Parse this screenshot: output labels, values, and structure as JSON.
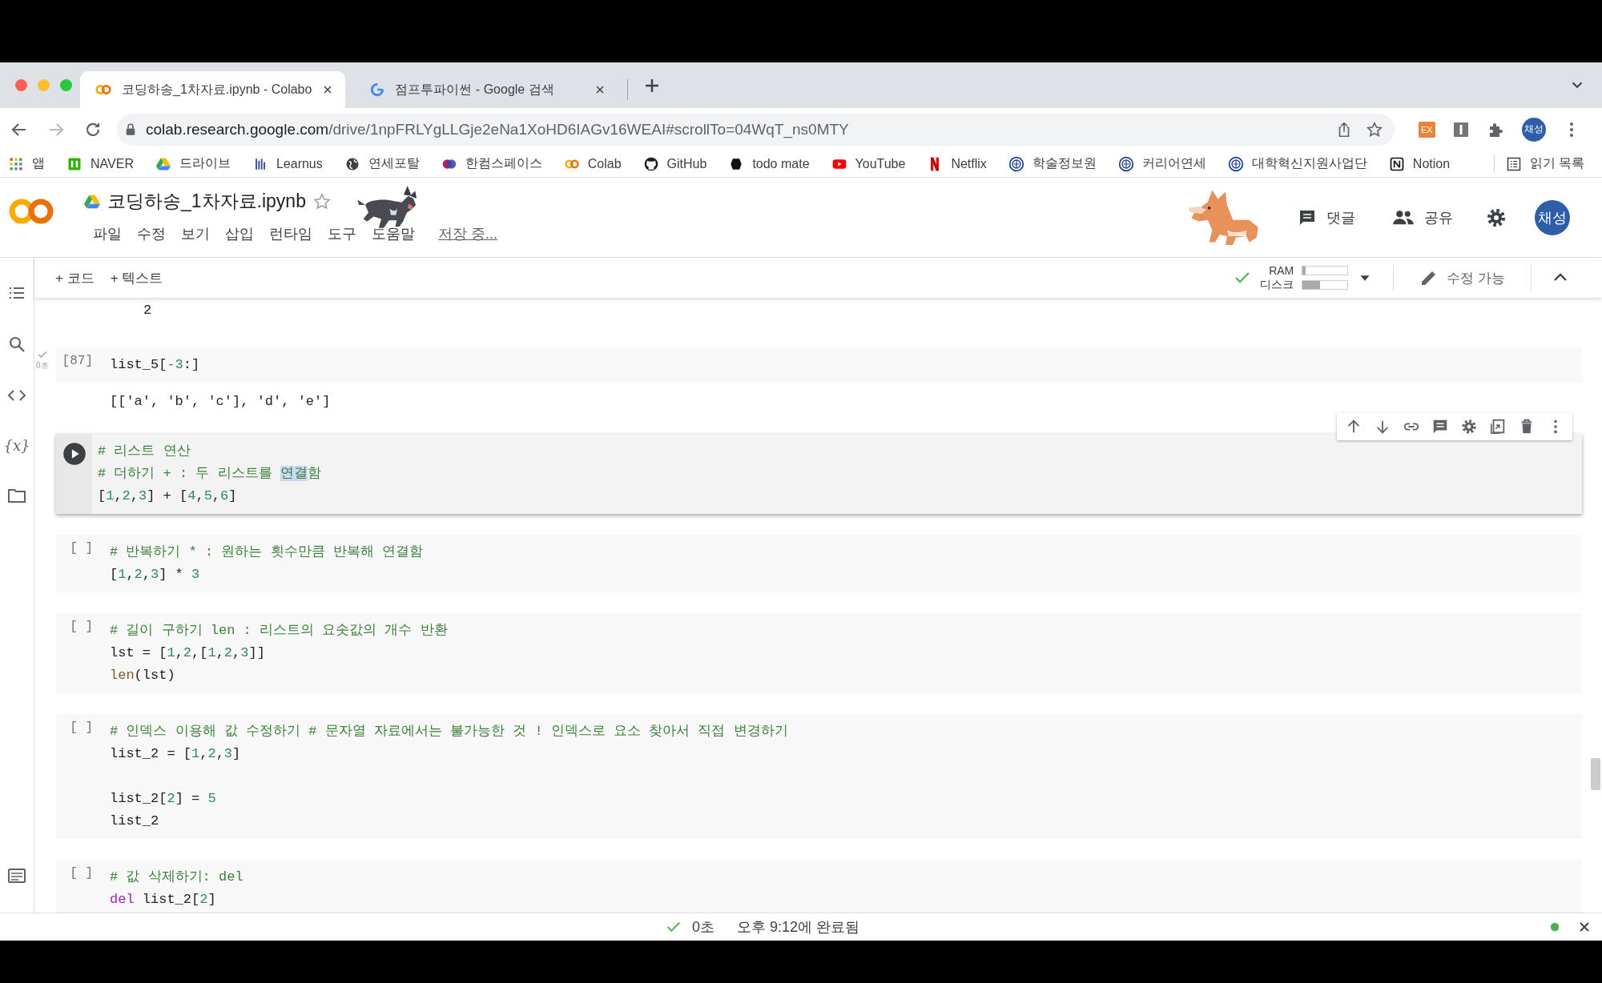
{
  "browser": {
    "tabs": [
      {
        "title": "코딩하송_1차자료.ipynb - Colabo",
        "selected": true
      },
      {
        "title": "점프투파이썬 - Google 검색",
        "selected": false
      }
    ],
    "address": {
      "host": "colab.research.google.com",
      "path": "/drive/1npFRLYgLLGje2eNa1XoHD6IAGv16WEAI#scrollTo=04WqT_ns0MTY"
    },
    "extension_badge": "EX",
    "profile": "채성",
    "bookmarks": [
      {
        "label": "앱",
        "kind": "grid"
      },
      {
        "label": "NAVER",
        "kind": "square"
      },
      {
        "label": "드라이브",
        "kind": "drive"
      },
      {
        "label": "Learnus",
        "kind": "bars"
      },
      {
        "label": "연세포탈",
        "kind": "globe"
      },
      {
        "label": "한컴스페이스",
        "kind": "blob"
      },
      {
        "label": "Colab",
        "kind": "colab"
      },
      {
        "label": "GitHub",
        "kind": "cat"
      },
      {
        "label": "todo mate",
        "kind": "dot"
      },
      {
        "label": "YouTube",
        "kind": "play"
      },
      {
        "label": "Netflix",
        "kind": "stripes"
      },
      {
        "label": "학술정보원",
        "kind": "seal"
      },
      {
        "label": "커리어연세",
        "kind": "seal"
      },
      {
        "label": "대학혁신지원사업단",
        "kind": "seal"
      },
      {
        "label": "Notion",
        "kind": "cube"
      }
    ],
    "reading_list": "읽기 목록"
  },
  "notebook": {
    "title": "코딩하송_1차자료.ipynb",
    "menu": [
      "파일",
      "수정",
      "보기",
      "삽입",
      "런타임",
      "도구",
      "도움말"
    ],
    "save_status": "저장 중...",
    "comment": "댓글",
    "share": "공유",
    "avatar": "채성"
  },
  "toolbar": {
    "add_code": "+ 코드",
    "add_text": "+ 텍스트",
    "ram_label": "RAM",
    "ram": {
      "level": 0.06
    },
    "disk_label": "디스크",
    "disk": {
      "level": 0.38
    },
    "edit_mode": "수정 가능"
  },
  "rail": {
    "variables": "{x}"
  },
  "cells": [
    {
      "kind": "output",
      "output": [
        "2"
      ]
    },
    {
      "kind": "code",
      "prompt": "[87]",
      "executed": true,
      "time": "0초",
      "focused": false,
      "lines": [
        {
          "segments": [
            {
              "text": "list_5[",
              "kind": "plain"
            },
            {
              "text": "-3",
              "kind": "number"
            },
            {
              "text": ":]",
              "kind": "plain"
            }
          ]
        }
      ],
      "output": [
        "[['a', 'b', 'c'], 'd', 'e']"
      ]
    },
    {
      "kind": "code",
      "executed": false,
      "focused": true,
      "lines": [
        {
          "segments": [
            {
              "text": "# 리스트 연산",
              "kind": "comment"
            }
          ]
        },
        {
          "segments": [
            {
              "text": "# 더하기 + : 두 리스트를 ",
              "kind": "comment"
            },
            {
              "text": "연결",
              "kind": "selection"
            },
            {
              "text": "함",
              "kind": "comment"
            }
          ]
        },
        {
          "segments": [
            {
              "text": "[",
              "kind": "plain"
            },
            {
              "text": "1",
              "kind": "number"
            },
            {
              "text": ",",
              "kind": "plain"
            },
            {
              "text": "2",
              "kind": "number"
            },
            {
              "text": ",",
              "kind": "plain"
            },
            {
              "text": "3",
              "kind": "number"
            },
            {
              "text": "] + [",
              "kind": "plain"
            },
            {
              "text": "4",
              "kind": "number"
            },
            {
              "text": ",",
              "kind": "plain"
            },
            {
              "text": "5",
              "kind": "number"
            },
            {
              "text": ",",
              "kind": "plain"
            },
            {
              "text": "6",
              "kind": "number"
            },
            {
              "text": "]",
              "kind": "plain"
            }
          ]
        }
      ]
    },
    {
      "kind": "code",
      "prompt": "[ ]",
      "executed": false,
      "focused": false,
      "lines": [
        {
          "segments": [
            {
              "text": "# 반복하기 * : 원하는 횟수만큼 반복해 연결함",
              "kind": "comment"
            }
          ]
        },
        {
          "segments": [
            {
              "text": "[",
              "kind": "plain"
            },
            {
              "text": "1",
              "kind": "number"
            },
            {
              "text": ",",
              "kind": "plain"
            },
            {
              "text": "2",
              "kind": "number"
            },
            {
              "text": ",",
              "kind": "plain"
            },
            {
              "text": "3",
              "kind": "number"
            },
            {
              "text": "] * ",
              "kind": "plain"
            },
            {
              "text": "3",
              "kind": "number"
            }
          ]
        }
      ]
    },
    {
      "kind": "code",
      "prompt": "[ ]",
      "executed": false,
      "focused": false,
      "lines": [
        {
          "segments": [
            {
              "text": "# 길이 구하기 len : 리스트의 요솟값의 개수 반환",
              "kind": "comment"
            }
          ]
        },
        {
          "segments": [
            {
              "text": "lst = [",
              "kind": "plain"
            },
            {
              "text": "1",
              "kind": "number"
            },
            {
              "text": ",",
              "kind": "plain"
            },
            {
              "text": "2",
              "kind": "number"
            },
            {
              "text": ",[",
              "kind": "plain"
            },
            {
              "text": "1",
              "kind": "number"
            },
            {
              "text": ",",
              "kind": "plain"
            },
            {
              "text": "2",
              "kind": "number"
            },
            {
              "text": ",",
              "kind": "plain"
            },
            {
              "text": "3",
              "kind": "number"
            },
            {
              "text": "]]",
              "kind": "plain"
            }
          ]
        },
        {
          "segments": [
            {
              "text": "len",
              "kind": "builtin"
            },
            {
              "text": "(lst)",
              "kind": "plain"
            }
          ]
        }
      ]
    },
    {
      "kind": "code",
      "prompt": "[ ]",
      "executed": false,
      "focused": false,
      "lines": [
        {
          "segments": [
            {
              "text": "# 인덱스 이용해 값 수정하기 # 문자열 자료에서는 불가능한 것 ! 인덱스로 요소 찾아서 직접 변경하기",
              "kind": "comment"
            }
          ]
        },
        {
          "segments": [
            {
              "text": "list_2 = [",
              "kind": "plain"
            },
            {
              "text": "1",
              "kind": "number"
            },
            {
              "text": ",",
              "kind": "plain"
            },
            {
              "text": "2",
              "kind": "number"
            },
            {
              "text": ",",
              "kind": "plain"
            },
            {
              "text": "3",
              "kind": "number"
            },
            {
              "text": "]",
              "kind": "plain"
            }
          ]
        }
      ],
      "lines_after_blank": [
        {
          "segments": [
            {
              "text": "list_2[",
              "kind": "plain"
            },
            {
              "text": "2",
              "kind": "number"
            },
            {
              "text": "] = ",
              "kind": "plain"
            },
            {
              "text": "5",
              "kind": "number"
            }
          ]
        },
        {
          "segments": [
            {
              "text": "list_2",
              "kind": "plain"
            }
          ]
        }
      ]
    },
    {
      "kind": "code",
      "prompt": "[ ]",
      "executed": false,
      "focused": false,
      "lines": [
        {
          "segments": [
            {
              "text": "# 값 삭제하기: del",
              "kind": "comment"
            }
          ]
        },
        {
          "segments": [
            {
              "text": "del",
              "kind": "keyword"
            },
            {
              "text": " list_2[",
              "kind": "plain"
            },
            {
              "text": "2",
              "kind": "number"
            },
            {
              "text": "]",
              "kind": "plain"
            }
          ]
        }
      ]
    }
  ],
  "status": {
    "duration": "0초",
    "message": "오후 9:12에 완료됨"
  }
}
